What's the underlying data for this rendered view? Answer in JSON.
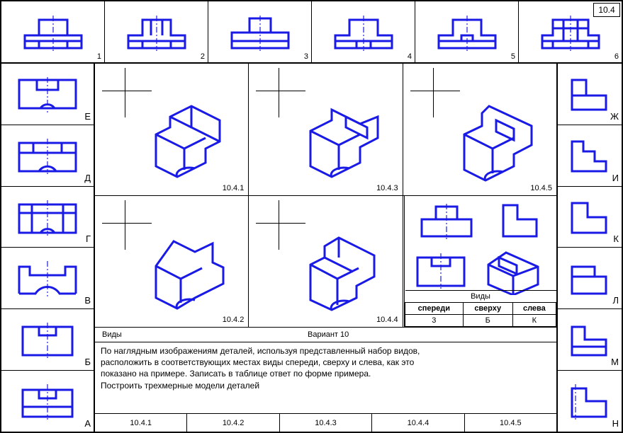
{
  "corner": "10.4",
  "top_numbers": [
    "1",
    "2",
    "3",
    "4",
    "5",
    "6"
  ],
  "left_labels": [
    "Е",
    "Д",
    "Г",
    "В",
    "Б",
    "А"
  ],
  "right_labels": [
    "Ж",
    "И",
    "К",
    "Л",
    "М",
    "Н"
  ],
  "iso_cells": {
    "r1": [
      "10.4.1",
      "10.4.3",
      "10.4.5"
    ],
    "r2": [
      "10.4.2",
      "10.4.4",
      ""
    ]
  },
  "example_table": {
    "title": "Виды",
    "headers": [
      "спереди",
      "сверху",
      "слева"
    ],
    "values": [
      "3",
      "Б",
      "К"
    ]
  },
  "strip": {
    "left": "Виды",
    "right": "Вариант  10"
  },
  "instructions": [
    "По наглядным изображениям деталей, используя представленный набор видов,",
    "расположить в соответствующих местах виды спереди, сверху и слева, как это",
    "показано на примере. Записать в таблице ответ по форме  примера.",
    "Построить трехмерные модели деталей"
  ],
  "bottom_answers": [
    "10.4.1",
    "10.4.2",
    "10.4.3",
    "10.4.4",
    "10.4.5"
  ]
}
